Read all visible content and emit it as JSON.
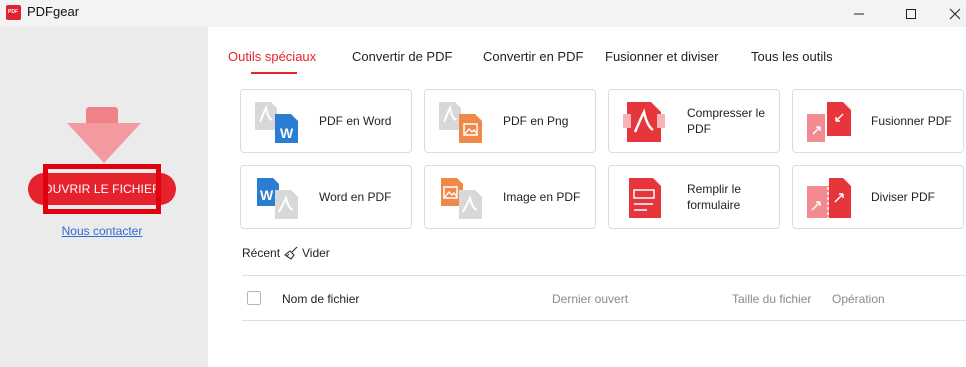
{
  "app": {
    "title": "PDFgear",
    "logo_text": "PDF"
  },
  "sidebar": {
    "open_label": "OUVRIR LE FICHIER",
    "contact_label": "Nous contacter"
  },
  "tabs": [
    {
      "label": "Outils spéciaux",
      "active": true
    },
    {
      "label": "Convertir de PDF",
      "active": false
    },
    {
      "label": "Convertir en PDF",
      "active": false
    },
    {
      "label": "Fusionner et diviser",
      "active": false
    },
    {
      "label": "Tous les outils",
      "active": false
    }
  ],
  "tools": [
    {
      "label": "PDF en Word",
      "icon": "pdf-to-word-icon"
    },
    {
      "label": "PDF en Png",
      "icon": "pdf-to-png-icon"
    },
    {
      "label": "Compresser le PDF",
      "icon": "compress-pdf-icon"
    },
    {
      "label": "Fusionner PDF",
      "icon": "merge-pdf-icon"
    },
    {
      "label": "Word en PDF",
      "icon": "word-to-pdf-icon"
    },
    {
      "label": "Image en PDF",
      "icon": "image-to-pdf-icon"
    },
    {
      "label": "Remplir le formulaire",
      "icon": "fill-form-icon"
    },
    {
      "label": "Diviser PDF",
      "icon": "split-pdf-icon"
    }
  ],
  "recent": {
    "label": "Récent",
    "clear_label": "Vider",
    "columns": [
      "Nom de fichier",
      "Dernier ouvert",
      "Taille du fichier",
      "Opération"
    ]
  },
  "colors": {
    "accent": "#e6222c",
    "word_blue": "#2b7cd3",
    "image_orange": "#f0884a",
    "link": "#2d6bd6"
  }
}
